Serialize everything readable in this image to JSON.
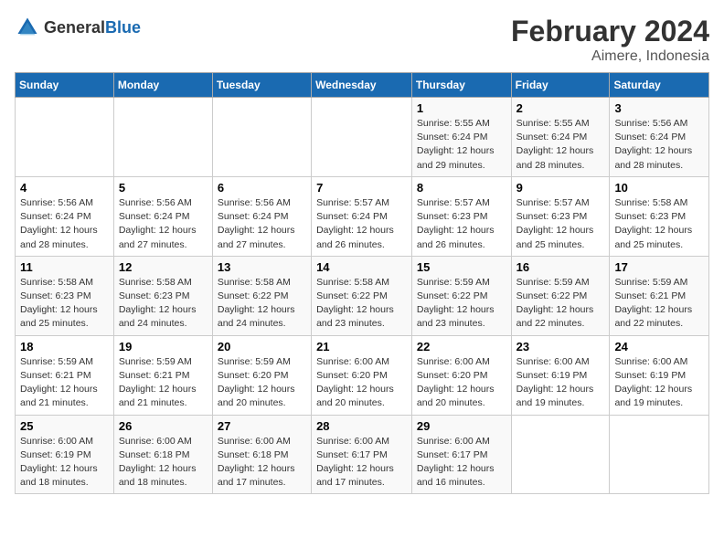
{
  "header": {
    "logo_general": "General",
    "logo_blue": "Blue",
    "title": "February 2024",
    "subtitle": "Aimere, Indonesia"
  },
  "days_of_week": [
    "Sunday",
    "Monday",
    "Tuesday",
    "Wednesday",
    "Thursday",
    "Friday",
    "Saturday"
  ],
  "weeks": [
    [
      {
        "day": null
      },
      {
        "day": null
      },
      {
        "day": null
      },
      {
        "day": null
      },
      {
        "day": 1,
        "sunrise": "5:55 AM",
        "sunset": "6:24 PM",
        "daylight": "12 hours and 29 minutes."
      },
      {
        "day": 2,
        "sunrise": "5:55 AM",
        "sunset": "6:24 PM",
        "daylight": "12 hours and 28 minutes."
      },
      {
        "day": 3,
        "sunrise": "5:56 AM",
        "sunset": "6:24 PM",
        "daylight": "12 hours and 28 minutes."
      }
    ],
    [
      {
        "day": 4,
        "sunrise": "5:56 AM",
        "sunset": "6:24 PM",
        "daylight": "12 hours and 28 minutes."
      },
      {
        "day": 5,
        "sunrise": "5:56 AM",
        "sunset": "6:24 PM",
        "daylight": "12 hours and 27 minutes."
      },
      {
        "day": 6,
        "sunrise": "5:56 AM",
        "sunset": "6:24 PM",
        "daylight": "12 hours and 27 minutes."
      },
      {
        "day": 7,
        "sunrise": "5:57 AM",
        "sunset": "6:24 PM",
        "daylight": "12 hours and 26 minutes."
      },
      {
        "day": 8,
        "sunrise": "5:57 AM",
        "sunset": "6:23 PM",
        "daylight": "12 hours and 26 minutes."
      },
      {
        "day": 9,
        "sunrise": "5:57 AM",
        "sunset": "6:23 PM",
        "daylight": "12 hours and 25 minutes."
      },
      {
        "day": 10,
        "sunrise": "5:58 AM",
        "sunset": "6:23 PM",
        "daylight": "12 hours and 25 minutes."
      }
    ],
    [
      {
        "day": 11,
        "sunrise": "5:58 AM",
        "sunset": "6:23 PM",
        "daylight": "12 hours and 25 minutes."
      },
      {
        "day": 12,
        "sunrise": "5:58 AM",
        "sunset": "6:23 PM",
        "daylight": "12 hours and 24 minutes."
      },
      {
        "day": 13,
        "sunrise": "5:58 AM",
        "sunset": "6:22 PM",
        "daylight": "12 hours and 24 minutes."
      },
      {
        "day": 14,
        "sunrise": "5:58 AM",
        "sunset": "6:22 PM",
        "daylight": "12 hours and 23 minutes."
      },
      {
        "day": 15,
        "sunrise": "5:59 AM",
        "sunset": "6:22 PM",
        "daylight": "12 hours and 23 minutes."
      },
      {
        "day": 16,
        "sunrise": "5:59 AM",
        "sunset": "6:22 PM",
        "daylight": "12 hours and 22 minutes."
      },
      {
        "day": 17,
        "sunrise": "5:59 AM",
        "sunset": "6:21 PM",
        "daylight": "12 hours and 22 minutes."
      }
    ],
    [
      {
        "day": 18,
        "sunrise": "5:59 AM",
        "sunset": "6:21 PM",
        "daylight": "12 hours and 21 minutes."
      },
      {
        "day": 19,
        "sunrise": "5:59 AM",
        "sunset": "6:21 PM",
        "daylight": "12 hours and 21 minutes."
      },
      {
        "day": 20,
        "sunrise": "5:59 AM",
        "sunset": "6:20 PM",
        "daylight": "12 hours and 20 minutes."
      },
      {
        "day": 21,
        "sunrise": "6:00 AM",
        "sunset": "6:20 PM",
        "daylight": "12 hours and 20 minutes."
      },
      {
        "day": 22,
        "sunrise": "6:00 AM",
        "sunset": "6:20 PM",
        "daylight": "12 hours and 20 minutes."
      },
      {
        "day": 23,
        "sunrise": "6:00 AM",
        "sunset": "6:19 PM",
        "daylight": "12 hours and 19 minutes."
      },
      {
        "day": 24,
        "sunrise": "6:00 AM",
        "sunset": "6:19 PM",
        "daylight": "12 hours and 19 minutes."
      }
    ],
    [
      {
        "day": 25,
        "sunrise": "6:00 AM",
        "sunset": "6:19 PM",
        "daylight": "12 hours and 18 minutes."
      },
      {
        "day": 26,
        "sunrise": "6:00 AM",
        "sunset": "6:18 PM",
        "daylight": "12 hours and 18 minutes."
      },
      {
        "day": 27,
        "sunrise": "6:00 AM",
        "sunset": "6:18 PM",
        "daylight": "12 hours and 17 minutes."
      },
      {
        "day": 28,
        "sunrise": "6:00 AM",
        "sunset": "6:17 PM",
        "daylight": "12 hours and 17 minutes."
      },
      {
        "day": 29,
        "sunrise": "6:00 AM",
        "sunset": "6:17 PM",
        "daylight": "12 hours and 16 minutes."
      },
      {
        "day": null
      },
      {
        "day": null
      }
    ]
  ],
  "labels": {
    "sunrise": "Sunrise:",
    "sunset": "Sunset:",
    "daylight": "Daylight:"
  }
}
